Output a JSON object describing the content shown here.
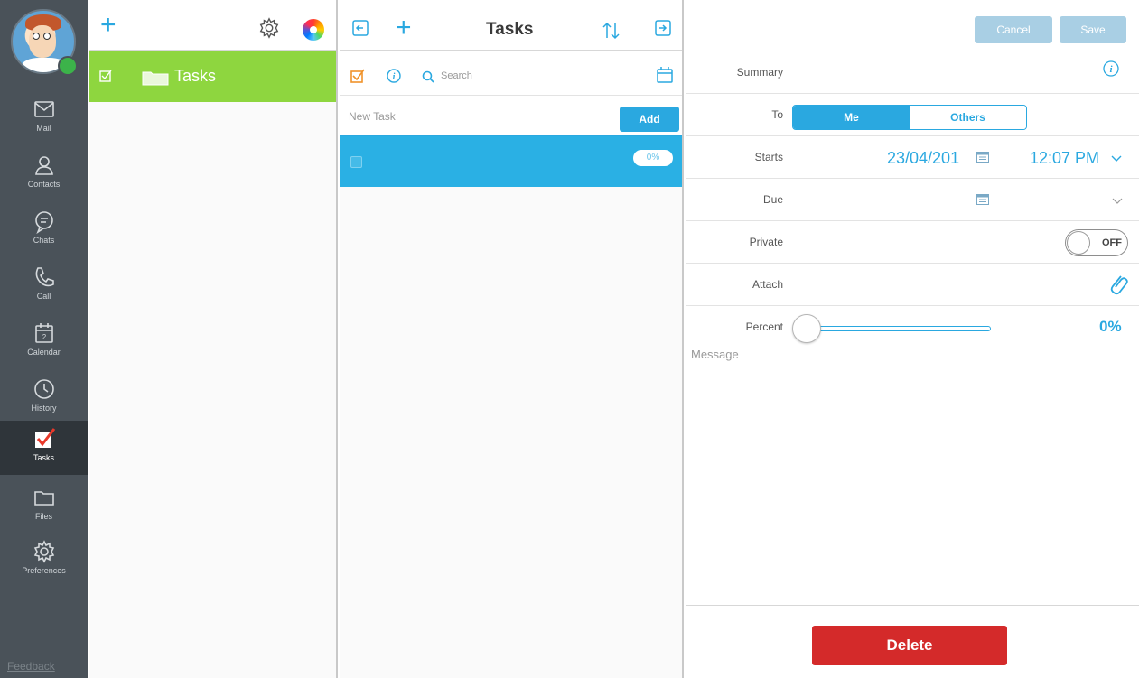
{
  "rail": {
    "items": [
      {
        "label": "Mail",
        "icon": "mail-icon"
      },
      {
        "label": "Contacts",
        "icon": "contacts-icon"
      },
      {
        "label": "Chats",
        "icon": "chat-icon"
      },
      {
        "label": "Call",
        "icon": "phone-icon"
      },
      {
        "label": "Calendar",
        "icon": "calendar-icon",
        "day": "2"
      },
      {
        "label": "History",
        "icon": "clock-icon"
      },
      {
        "label": "Tasks",
        "icon": "checkmark-icon",
        "active": true
      },
      {
        "label": "Files",
        "icon": "folder-icon"
      },
      {
        "label": "Preferences",
        "icon": "gear-icon"
      }
    ],
    "feedback": "Feedback"
  },
  "folders": {
    "items": [
      {
        "name": "Tasks",
        "selected": true
      }
    ]
  },
  "list": {
    "title": "Tasks",
    "search_placeholder": "Search",
    "new_task_placeholder": "New Task",
    "add_label": "Add",
    "tasks": [
      {
        "name": "",
        "percent": "0%"
      }
    ]
  },
  "detail": {
    "cancel_label": "Cancel",
    "save_label": "Save",
    "summary_label": "Summary",
    "to_label": "To",
    "to_options": [
      "Me",
      "Others"
    ],
    "starts_label": "Starts",
    "starts_date": "23/04/201",
    "starts_time": "12:07 PM",
    "due_label": "Due",
    "private_label": "Private",
    "private_state": "OFF",
    "attach_label": "Attach",
    "percent_label": "Percent",
    "percent_value": "0%",
    "message_placeholder": "Message",
    "delete_label": "Delete"
  },
  "colors": {
    "accent": "#2aa8e0",
    "folder_selected": "#8ed63f",
    "rail_bg": "#4a5259",
    "delete": "#d42a2a"
  }
}
